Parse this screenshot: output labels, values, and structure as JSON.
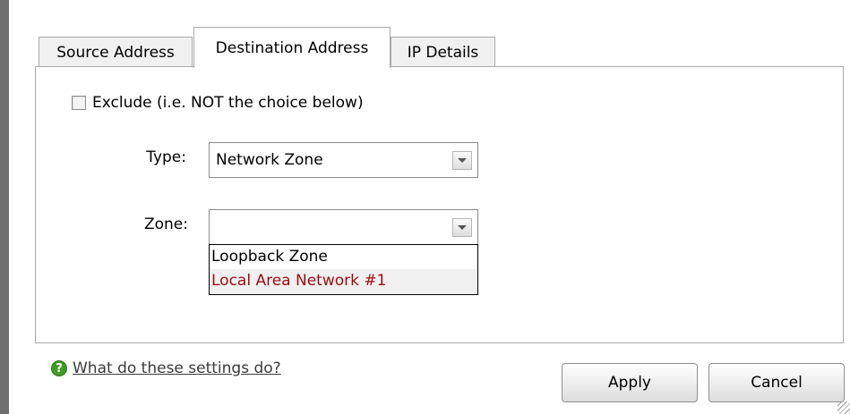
{
  "tabs": [
    {
      "label": "Source Address"
    },
    {
      "label": "Destination Address",
      "active": true
    },
    {
      "label": "IP Details"
    }
  ],
  "exclude": {
    "label": "Exclude (i.e. NOT the choice below)",
    "checked": false
  },
  "type": {
    "label": "Type:",
    "value": "Network Zone"
  },
  "zone": {
    "label": "Zone:",
    "value": "",
    "options": [
      "Loopback Zone",
      "Local Area Network #1"
    ],
    "highlighted": "Local Area Network #1",
    "highlight_color": "#9c0d0d"
  },
  "help": {
    "icon": "help-icon",
    "glyph": "?",
    "link": "What do these settings do?"
  },
  "buttons": {
    "apply": "Apply",
    "cancel": "Cancel"
  }
}
